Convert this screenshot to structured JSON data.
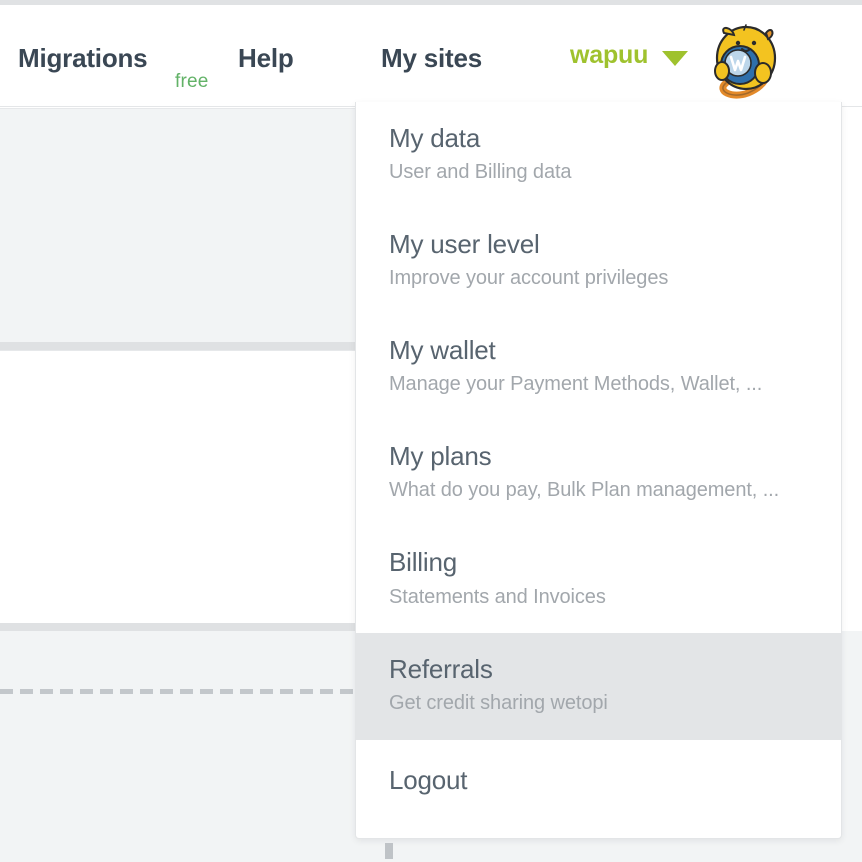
{
  "header": {
    "nav": [
      {
        "label": "Migrations",
        "badge": "free"
      },
      {
        "label": "Help"
      },
      {
        "label": "My sites"
      }
    ],
    "migrations_label": "Migrations",
    "migrations_badge": "free",
    "help_label": "Help",
    "my_sites_label": "My sites",
    "user_name": "wapuu",
    "caret_icon": "chevron-down-icon",
    "avatar_icon": "wapuu-avatar"
  },
  "dropdown": {
    "items": [
      {
        "title": "My data",
        "subtitle": "User and Billing data",
        "active": false
      },
      {
        "title": "My user level",
        "subtitle": "Improve your account privileges",
        "active": false
      },
      {
        "title": "My wallet",
        "subtitle": "Manage your Payment Methods, Wallet, ...",
        "active": false
      },
      {
        "title": "My plans",
        "subtitle": "What do you pay, Bulk Plan management, ...",
        "active": false
      },
      {
        "title": "Billing",
        "subtitle": "Statements and Invoices",
        "active": false
      },
      {
        "title": "Referrals",
        "subtitle": "Get credit sharing wetopi",
        "active": true
      },
      {
        "title": "Logout",
        "subtitle": "",
        "active": false
      }
    ]
  },
  "colors": {
    "brand_green": "#9fc22e",
    "free_green": "#62b267",
    "nav_text": "#3a4754",
    "menu_title": "#58646f",
    "menu_subtitle": "#a2a7ac",
    "active_row": "#e3e5e7",
    "page_gray": "#f2f4f5"
  }
}
